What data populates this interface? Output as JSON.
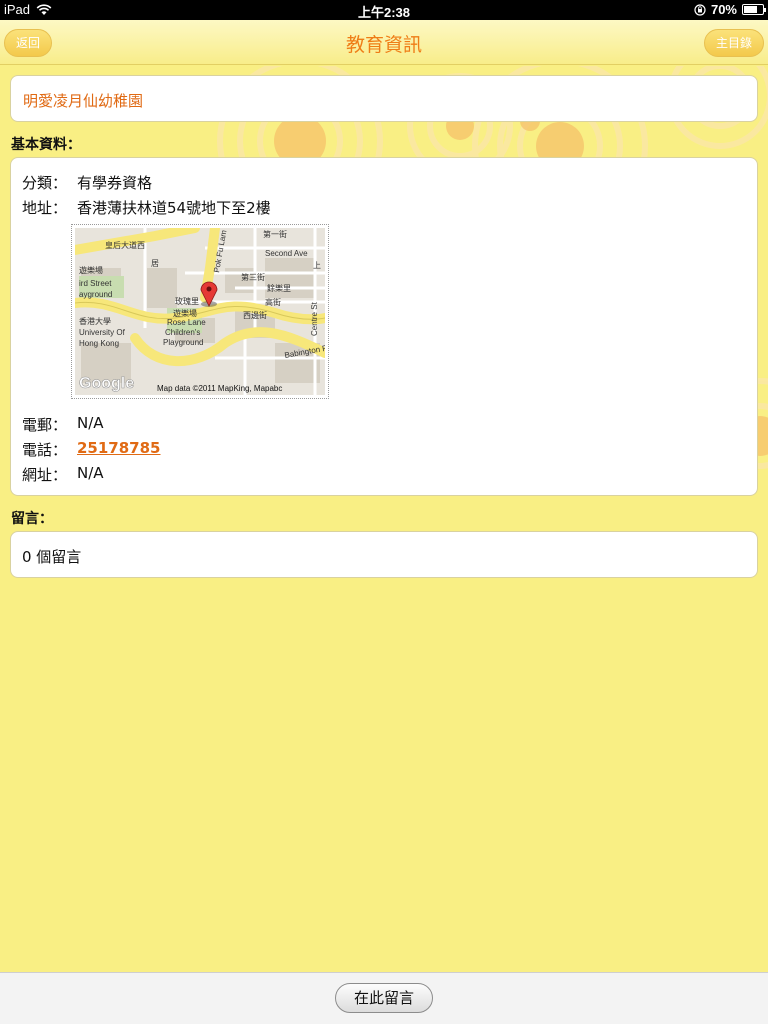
{
  "status_bar": {
    "device": "iPad",
    "time": "上午2:38",
    "battery": "70%",
    "battery_level": 0.7
  },
  "nav": {
    "title": "教育資訊",
    "back_label": "返回",
    "home_label": "主目錄"
  },
  "school": {
    "name": "明愛凌月仙幼稚園"
  },
  "basic_info": {
    "section_label": "基本資料：",
    "category_key": "分類：",
    "category_value": "有學券資格",
    "address_key": "地址：",
    "address_value": "香港薄扶林道54號地下至2樓",
    "email_key": "電郵：",
    "email_value": "N/A",
    "phone_key": "電話：",
    "phone_value": "25178785",
    "website_key": "網址：",
    "website_value": "N/A"
  },
  "map": {
    "logo": "Google",
    "attribution": "Map data ©2011 MapKing, Mapabc",
    "labels": [
      "皇后大道西",
      "第一街",
      "Second Ave",
      "第三街",
      "餘樂里",
      "高街",
      "遊樂場",
      "ird Street",
      "ayground",
      "玫瑰里",
      "遊樂場",
      "香港大學",
      "University Of",
      "Hong Kong",
      "Rose Lane",
      "Children's",
      "Playground",
      "西邊街",
      "Centre St",
      "Babington Pa",
      "Pok Fu Lam",
      "居",
      "上"
    ]
  },
  "comments": {
    "section_label": "留言：",
    "count_text": "0 個留言"
  },
  "toolbar": {
    "leave_comment_label": "在此留言"
  }
}
